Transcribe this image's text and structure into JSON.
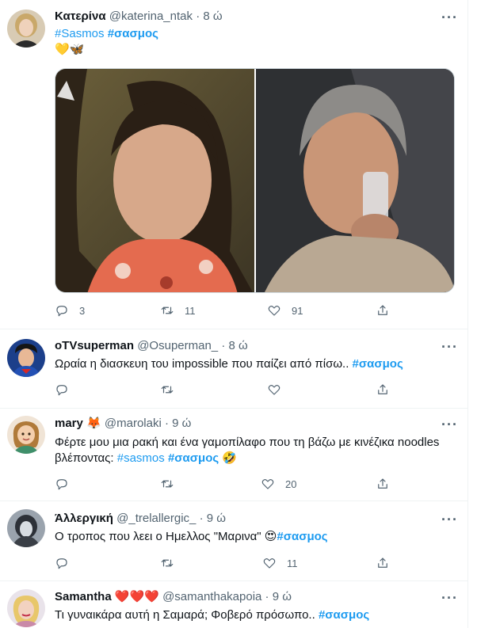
{
  "tweets": [
    {
      "name": "Κατερίνα",
      "handle": "@katerina_ntak",
      "time": "8 ώ",
      "lines": [
        {
          "segments": [
            {
              "text": "#Sasmos",
              "tag": true,
              "bold": false
            },
            {
              "text": " "
            },
            {
              "text": "#σασμος",
              "tag": true,
              "bold": true
            }
          ]
        },
        {
          "segments": [
            {
              "text": "💛🦋"
            }
          ]
        }
      ],
      "actions": {
        "reply": "3",
        "retweet": "11",
        "like": "91"
      }
    },
    {
      "name": "oTVsuperman",
      "handle": "@Osuperman_",
      "time": "8 ώ",
      "lines": [
        {
          "segments": [
            {
              "text": "Ωραία η διασκευη του impossible που παίζει από πίσω.. "
            },
            {
              "text": "#σασμος",
              "tag": true,
              "bold": true
            }
          ]
        }
      ],
      "actions": {
        "reply": "",
        "retweet": "",
        "like": ""
      }
    },
    {
      "name": "mary 🦊",
      "handle": "@marolaki",
      "time": "9 ώ",
      "lines": [
        {
          "segments": [
            {
              "text": "Φέρτε μου μια ρακή και ένα γαμοπίλαφο που τη βάζω με κινέζικα noodles"
            }
          ]
        },
        {
          "segments": [
            {
              "text": "βλέποντας: "
            },
            {
              "text": "#sasmos",
              "tag": true,
              "bold": false
            },
            {
              "text": " "
            },
            {
              "text": "#σασμος",
              "tag": true,
              "bold": true
            },
            {
              "text": " 🤣"
            }
          ]
        }
      ],
      "actions": {
        "reply": "",
        "retweet": "",
        "like": "20"
      }
    },
    {
      "name": "Άλλεργική",
      "handle": "@_trelallergic_",
      "time": "9 ώ",
      "lines": [
        {
          "segments": [
            {
              "text": "Ο τροπος που λεει ο Ημελλος \"Μαρινα\" 😍"
            },
            {
              "text": "#σασμος",
              "tag": true,
              "bold": true
            }
          ]
        }
      ],
      "actions": {
        "reply": "",
        "retweet": "",
        "like": "11"
      }
    },
    {
      "name": "Samantha ❤️❤️❤️",
      "handle": "@samanthakapoia",
      "time": "9 ώ",
      "lines": [
        {
          "segments": [
            {
              "text": "Τι γυναικάρα αυτή η Σαμαρά; Φοβερό πρόσωπο.. "
            },
            {
              "text": "#σασμος",
              "tag": true,
              "bold": true
            }
          ]
        }
      ],
      "actions": {
        "reply": "",
        "retweet": "",
        "like": ""
      }
    }
  ],
  "colors": {
    "accent": "#1d9bf0",
    "text": "#0f1419",
    "muted": "#536471",
    "divider": "#eff3f4"
  },
  "icons": {
    "reply": "reply-icon",
    "retweet": "retweet-icon",
    "like": "heart-icon",
    "share": "share-icon",
    "more": "more-icon"
  }
}
